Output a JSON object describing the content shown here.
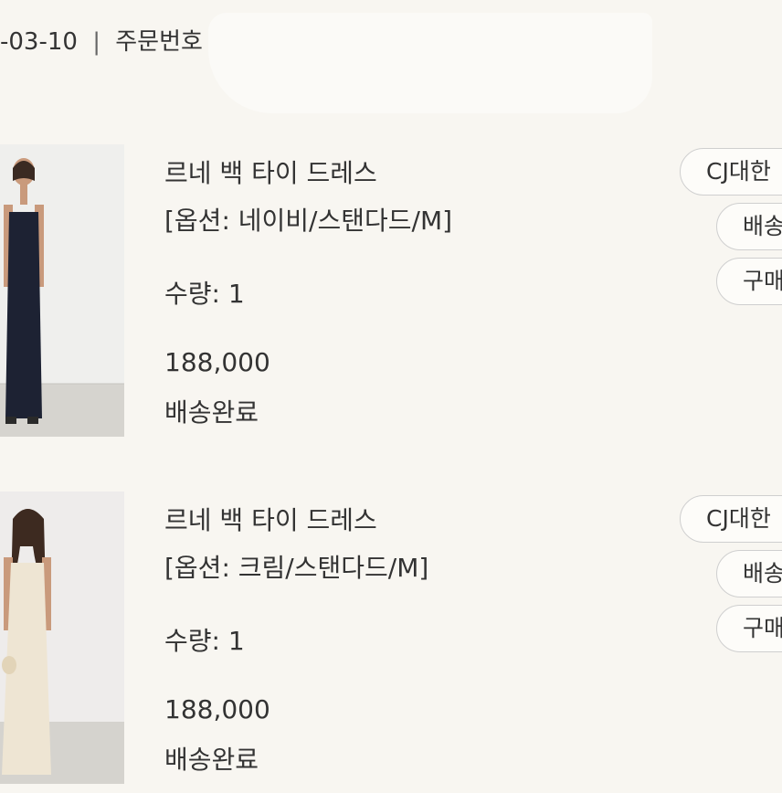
{
  "header": {
    "order_date_fragment": "-03-10",
    "separator": "|",
    "order_number_label": "주문번호"
  },
  "orders": [
    {
      "product_name": "르네 백 타이 드레스",
      "option": "[옵션: 네이비/스탠다드/M]",
      "quantity": "수량: 1",
      "price": "188,000",
      "status": "배송완료",
      "color": "#1d2233",
      "buttons": {
        "courier": "CJ대한",
        "delivery": "배송",
        "confirm": "구매"
      }
    },
    {
      "product_name": "르네 백 타이 드레스",
      "option": "[옵션: 크림/스탠다드/M]",
      "quantity": "수량: 1",
      "price": "188,000",
      "status": "배송완료",
      "color": "#eee5d3",
      "buttons": {
        "courier": "CJ대한",
        "delivery": "배송",
        "confirm": "구매"
      }
    }
  ]
}
